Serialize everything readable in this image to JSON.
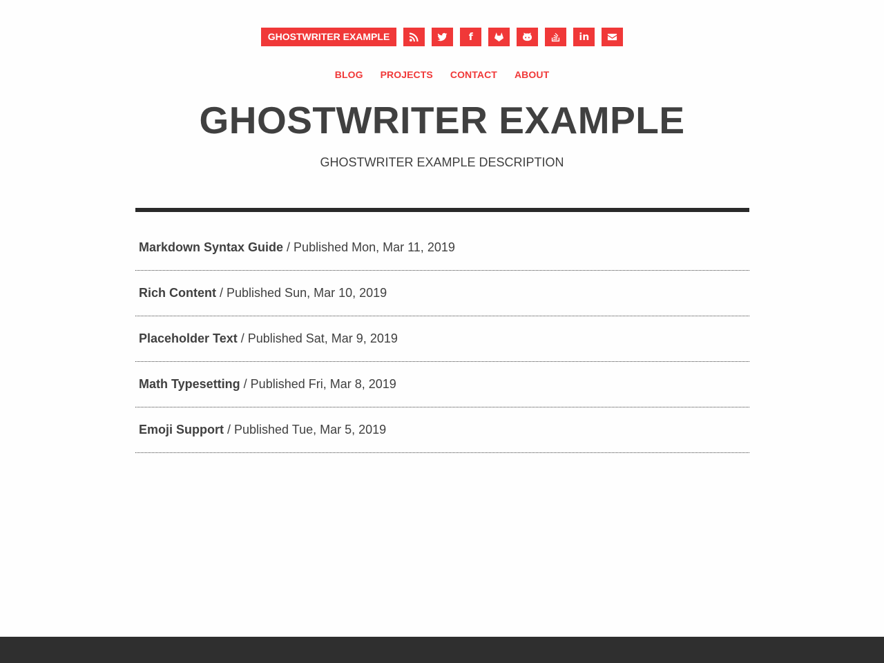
{
  "header": {
    "brand": "GHOSTWRITER EXAMPLE",
    "social": [
      {
        "icon": "rss-icon",
        "label": "RSS"
      },
      {
        "icon": "twitter-icon",
        "label": "Twitter"
      },
      {
        "icon": "facebook-icon",
        "label": "Facebook",
        "glyph": "f"
      },
      {
        "icon": "gitlab-icon",
        "label": "GitLab"
      },
      {
        "icon": "github-icon",
        "label": "GitHub"
      },
      {
        "icon": "stackoverflow-icon",
        "label": "Stack Overflow"
      },
      {
        "icon": "linkedin-icon",
        "label": "LinkedIn",
        "glyph": "in"
      },
      {
        "icon": "email-icon",
        "label": "Email"
      }
    ]
  },
  "nav": {
    "blog": "BLOG",
    "projects": "PROJECTS",
    "contact": "CONTACT",
    "about": "ABOUT"
  },
  "site": {
    "title": "GHOSTWRITER EXAMPLE",
    "description": "GHOSTWRITER EXAMPLE DESCRIPTION"
  },
  "posts": [
    {
      "title": "Markdown Syntax Guide",
      "meta": " / Published Mon, Mar 11, 2019"
    },
    {
      "title": "Rich Content",
      "meta": " / Published Sun, Mar 10, 2019"
    },
    {
      "title": "Placeholder Text",
      "meta": " / Published Sat, Mar 9, 2019"
    },
    {
      "title": "Math Typesetting",
      "meta": " / Published Fri, Mar 8, 2019"
    },
    {
      "title": "Emoji Support",
      "meta": " / Published Tue, Mar 5, 2019"
    }
  ],
  "colors": {
    "accent": "#f03838",
    "text": "#404040",
    "rule": "#2a2a2a",
    "footer": "#2f2f2f",
    "background": "#fefefe"
  }
}
